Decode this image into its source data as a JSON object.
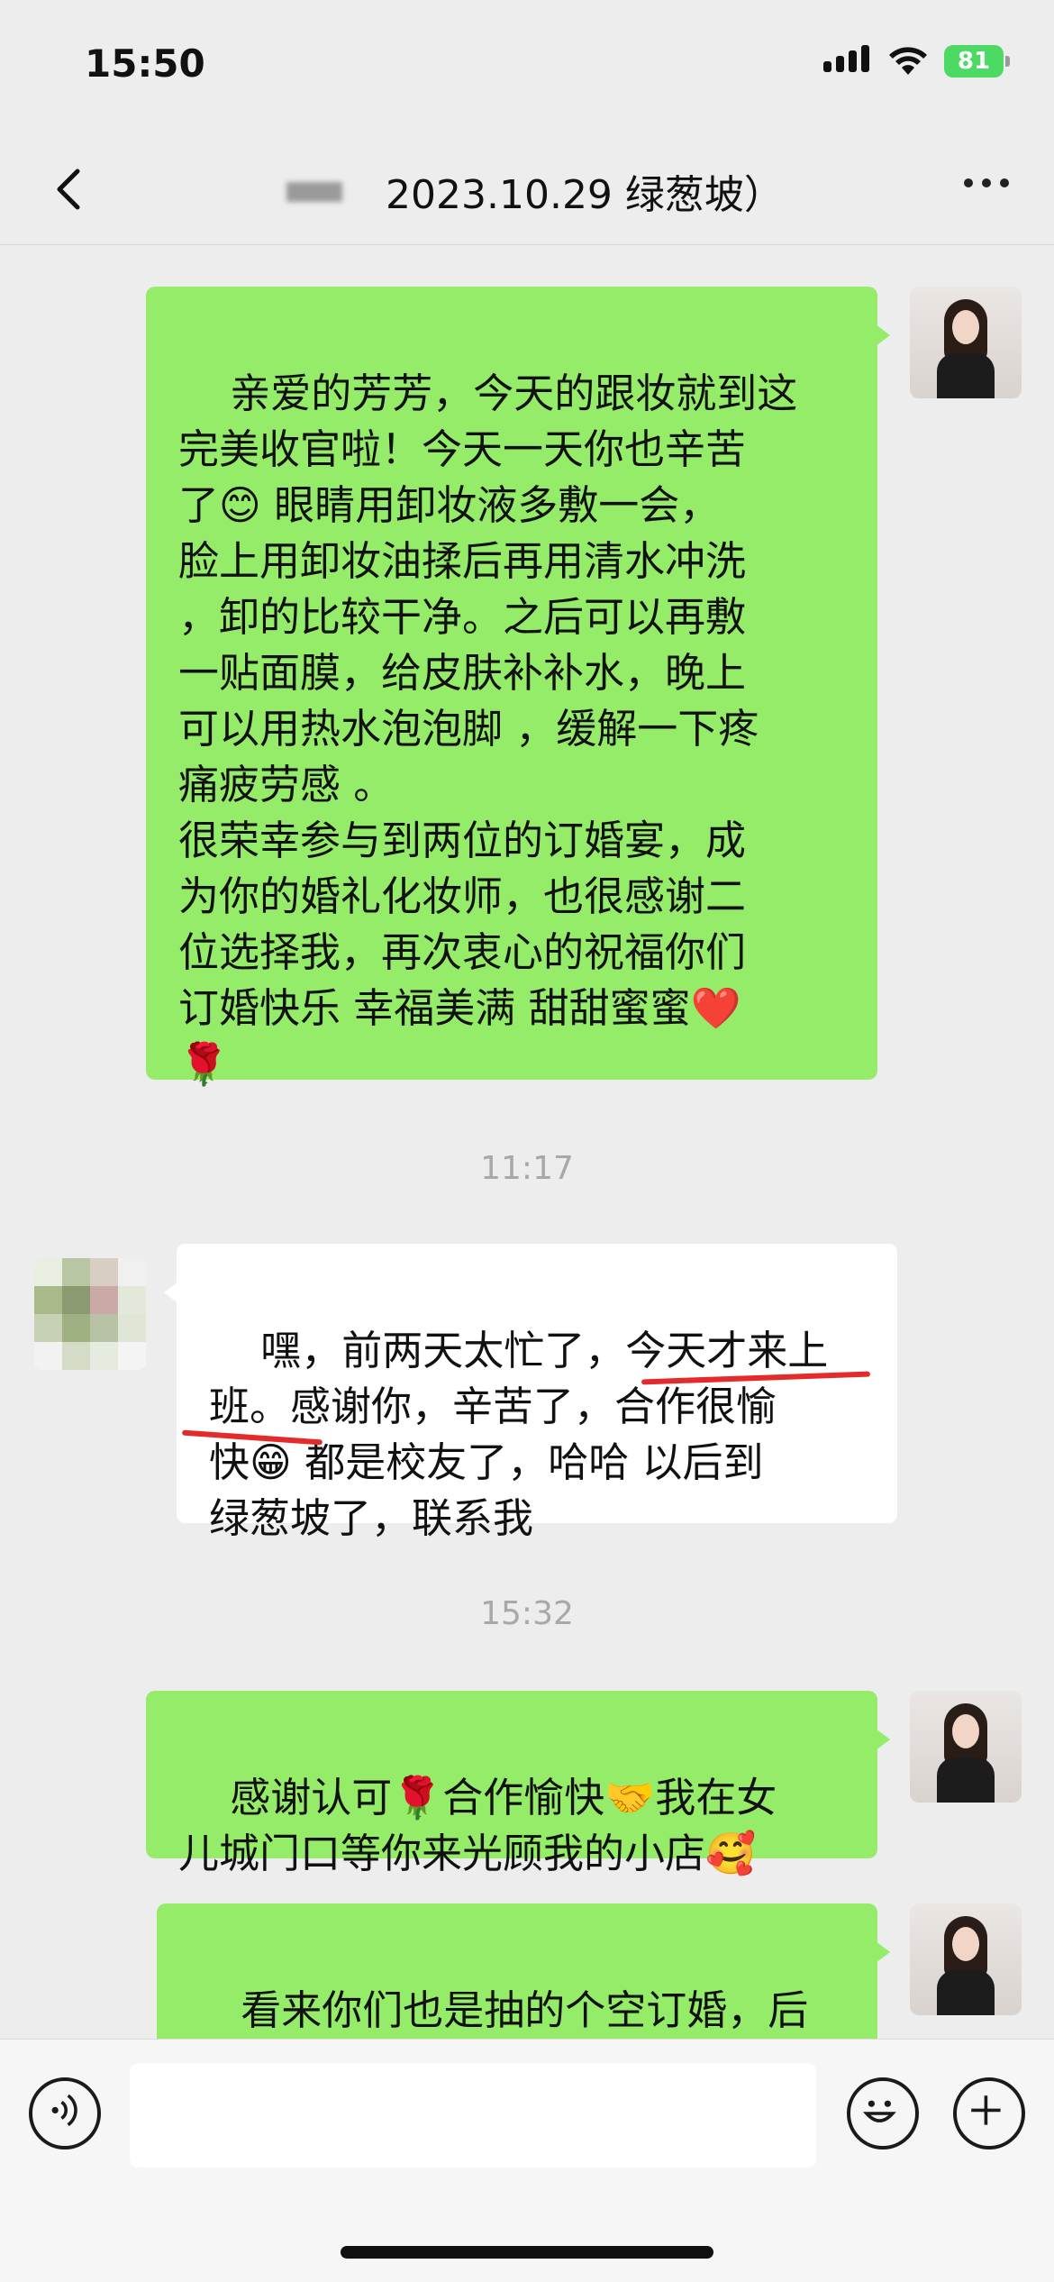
{
  "status_bar": {
    "time": "15:50",
    "battery": "81"
  },
  "nav": {
    "title": "2023.10.29 绿葱坡）"
  },
  "messages": [
    {
      "side": "right",
      "text": "亲爱的芳芳，今天的跟妆就到这\n完美收官啦！今天一天你也辛苦\n了😊 眼睛用卸妆液多敷一会，\n脸上用卸妆油揉后再用清水冲洗\n，卸的比较干净。之后可以再敷\n一贴面膜，给皮肤补补水，晚上\n可以用热水泡泡脚 ，缓解一下疼\n痛疲劳感 。\n很荣幸参与到两位的订婚宴，成\n为你的婚礼化妆师，也很感谢二\n位选择我，再次衷心的祝福你们\n订婚快乐 幸福美满 甜甜蜜蜜❤️\n🌹"
    },
    {
      "side": "left",
      "text": "嘿，前两天太忙了，今天才来上\n班。感谢你，辛苦了，合作很愉\n快😁 都是校友了，哈哈 以后到\n绿葱坡了，联系我"
    },
    {
      "side": "right",
      "text": "感谢认可🌹合作愉快🤝我在女\n儿城门口等你来光顾我的小店🥰"
    },
    {
      "side": "right",
      "text": "看来你们也是抽的个空订婚，后\n面还得抽个空结婚😂"
    }
  ],
  "timestamps": [
    "11:17",
    "15:32"
  ],
  "colors": {
    "bubble_self": "#95ec69",
    "bubble_other": "#ffffff",
    "background": "#ededed",
    "underline": "#e42a2a"
  }
}
